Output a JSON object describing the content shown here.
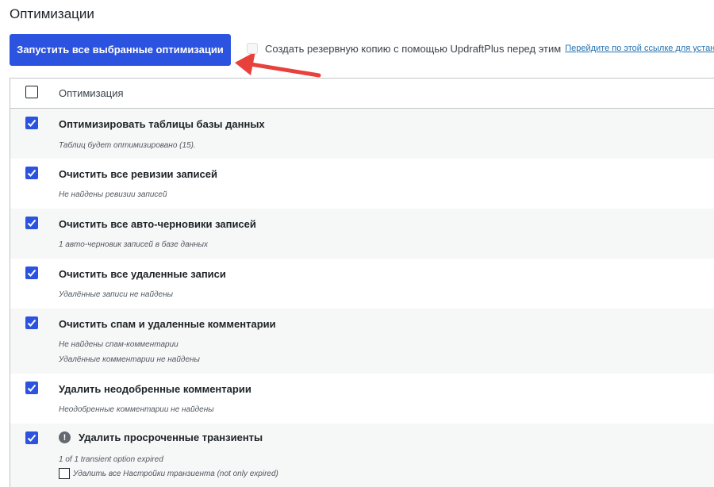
{
  "page": {
    "title": "Оптимизации"
  },
  "toolbar": {
    "run_label": "Запустить все выбранные оптимизации",
    "backup_label": "Создать резервную копию с помощью UpdraftPlus перед этим",
    "backup_link": "Перейдите по этой ссылке для устан",
    "backup_checked": false
  },
  "table": {
    "header_label": "Оптимизация",
    "rows": [
      {
        "title": "Оптимизировать таблицы базы данных",
        "notes": [
          "Таблиц будет оптимизировано (15)."
        ],
        "checked": true
      },
      {
        "title": "Очистить все ревизии записей",
        "notes": [
          "Не найдены ревизии записей"
        ],
        "checked": true
      },
      {
        "title": "Очистить все авто-черновики записей",
        "notes": [
          "1 авто-черновик записей в базе данных"
        ],
        "checked": true
      },
      {
        "title": "Очистить все удаленные записи",
        "notes": [
          "Удалённые записи не найдены"
        ],
        "checked": true
      },
      {
        "title": "Очистить спам и удаленные комментарии",
        "notes": [
          "Не найдены спам-комментарии",
          "Удалённые комментарии не найдены"
        ],
        "checked": true
      },
      {
        "title": "Удалить неодобренные комментарии",
        "notes": [
          "Неодобренные комментарии не найдены"
        ],
        "checked": true
      },
      {
        "title": "Удалить просроченные транзиенты",
        "notes": [
          "1 of 1 transient option expired"
        ],
        "checked": true,
        "icon": "warning-icon",
        "icon_glyph": "!",
        "sub_option": "Удалить все Настройки транзиента (not only expired)"
      }
    ]
  },
  "colors": {
    "accent": "#2b53e0",
    "arrow": "#e8413c",
    "alt_row": "#f6f7f7"
  }
}
